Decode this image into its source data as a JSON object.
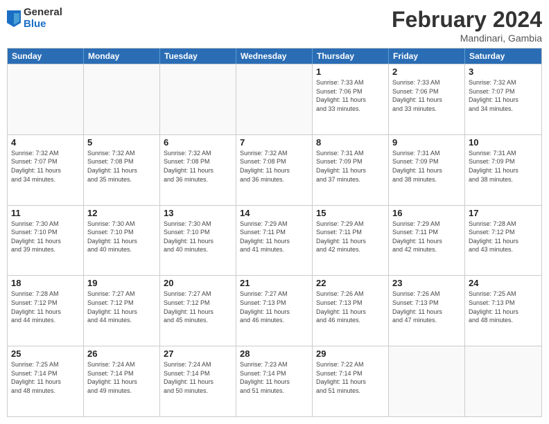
{
  "header": {
    "logo_general": "General",
    "logo_blue": "Blue",
    "title": "February 2024",
    "location": "Mandinari, Gambia"
  },
  "days_of_week": [
    "Sunday",
    "Monday",
    "Tuesday",
    "Wednesday",
    "Thursday",
    "Friday",
    "Saturday"
  ],
  "weeks": [
    [
      {
        "day": "",
        "info": ""
      },
      {
        "day": "",
        "info": ""
      },
      {
        "day": "",
        "info": ""
      },
      {
        "day": "",
        "info": ""
      },
      {
        "day": "1",
        "info": "Sunrise: 7:33 AM\nSunset: 7:06 PM\nDaylight: 11 hours\nand 33 minutes."
      },
      {
        "day": "2",
        "info": "Sunrise: 7:33 AM\nSunset: 7:06 PM\nDaylight: 11 hours\nand 33 minutes."
      },
      {
        "day": "3",
        "info": "Sunrise: 7:32 AM\nSunset: 7:07 PM\nDaylight: 11 hours\nand 34 minutes."
      }
    ],
    [
      {
        "day": "4",
        "info": "Sunrise: 7:32 AM\nSunset: 7:07 PM\nDaylight: 11 hours\nand 34 minutes."
      },
      {
        "day": "5",
        "info": "Sunrise: 7:32 AM\nSunset: 7:08 PM\nDaylight: 11 hours\nand 35 minutes."
      },
      {
        "day": "6",
        "info": "Sunrise: 7:32 AM\nSunset: 7:08 PM\nDaylight: 11 hours\nand 36 minutes."
      },
      {
        "day": "7",
        "info": "Sunrise: 7:32 AM\nSunset: 7:08 PM\nDaylight: 11 hours\nand 36 minutes."
      },
      {
        "day": "8",
        "info": "Sunrise: 7:31 AM\nSunset: 7:09 PM\nDaylight: 11 hours\nand 37 minutes."
      },
      {
        "day": "9",
        "info": "Sunrise: 7:31 AM\nSunset: 7:09 PM\nDaylight: 11 hours\nand 38 minutes."
      },
      {
        "day": "10",
        "info": "Sunrise: 7:31 AM\nSunset: 7:09 PM\nDaylight: 11 hours\nand 38 minutes."
      }
    ],
    [
      {
        "day": "11",
        "info": "Sunrise: 7:30 AM\nSunset: 7:10 PM\nDaylight: 11 hours\nand 39 minutes."
      },
      {
        "day": "12",
        "info": "Sunrise: 7:30 AM\nSunset: 7:10 PM\nDaylight: 11 hours\nand 40 minutes."
      },
      {
        "day": "13",
        "info": "Sunrise: 7:30 AM\nSunset: 7:10 PM\nDaylight: 11 hours\nand 40 minutes."
      },
      {
        "day": "14",
        "info": "Sunrise: 7:29 AM\nSunset: 7:11 PM\nDaylight: 11 hours\nand 41 minutes."
      },
      {
        "day": "15",
        "info": "Sunrise: 7:29 AM\nSunset: 7:11 PM\nDaylight: 11 hours\nand 42 minutes."
      },
      {
        "day": "16",
        "info": "Sunrise: 7:29 AM\nSunset: 7:11 PM\nDaylight: 11 hours\nand 42 minutes."
      },
      {
        "day": "17",
        "info": "Sunrise: 7:28 AM\nSunset: 7:12 PM\nDaylight: 11 hours\nand 43 minutes."
      }
    ],
    [
      {
        "day": "18",
        "info": "Sunrise: 7:28 AM\nSunset: 7:12 PM\nDaylight: 11 hours\nand 44 minutes."
      },
      {
        "day": "19",
        "info": "Sunrise: 7:27 AM\nSunset: 7:12 PM\nDaylight: 11 hours\nand 44 minutes."
      },
      {
        "day": "20",
        "info": "Sunrise: 7:27 AM\nSunset: 7:12 PM\nDaylight: 11 hours\nand 45 minutes."
      },
      {
        "day": "21",
        "info": "Sunrise: 7:27 AM\nSunset: 7:13 PM\nDaylight: 11 hours\nand 46 minutes."
      },
      {
        "day": "22",
        "info": "Sunrise: 7:26 AM\nSunset: 7:13 PM\nDaylight: 11 hours\nand 46 minutes."
      },
      {
        "day": "23",
        "info": "Sunrise: 7:26 AM\nSunset: 7:13 PM\nDaylight: 11 hours\nand 47 minutes."
      },
      {
        "day": "24",
        "info": "Sunrise: 7:25 AM\nSunset: 7:13 PM\nDaylight: 11 hours\nand 48 minutes."
      }
    ],
    [
      {
        "day": "25",
        "info": "Sunrise: 7:25 AM\nSunset: 7:14 PM\nDaylight: 11 hours\nand 48 minutes."
      },
      {
        "day": "26",
        "info": "Sunrise: 7:24 AM\nSunset: 7:14 PM\nDaylight: 11 hours\nand 49 minutes."
      },
      {
        "day": "27",
        "info": "Sunrise: 7:24 AM\nSunset: 7:14 PM\nDaylight: 11 hours\nand 50 minutes."
      },
      {
        "day": "28",
        "info": "Sunrise: 7:23 AM\nSunset: 7:14 PM\nDaylight: 11 hours\nand 51 minutes."
      },
      {
        "day": "29",
        "info": "Sunrise: 7:22 AM\nSunset: 7:14 PM\nDaylight: 11 hours\nand 51 minutes."
      },
      {
        "day": "",
        "info": ""
      },
      {
        "day": "",
        "info": ""
      }
    ]
  ]
}
